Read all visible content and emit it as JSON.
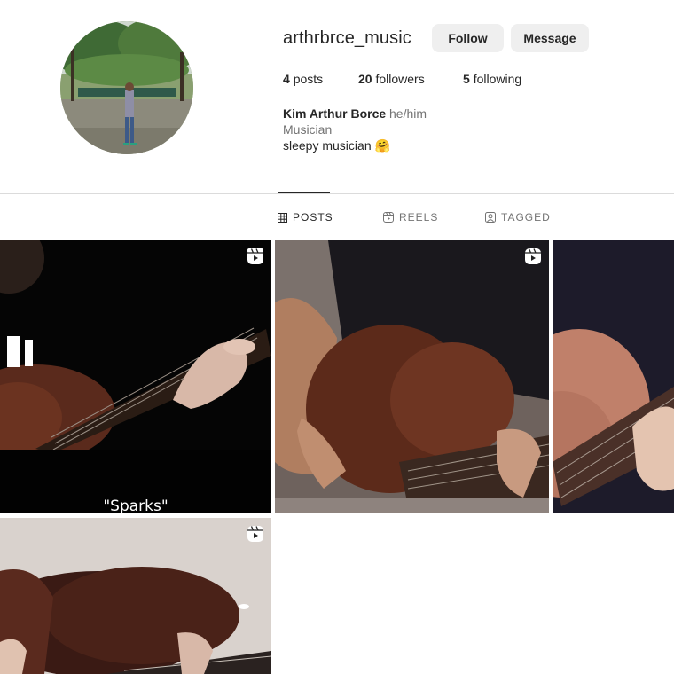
{
  "profile": {
    "username": "arthrbrce_music",
    "follow_label": "Follow",
    "message_label": "Message",
    "stats": {
      "posts_count": "4",
      "posts_label": "posts",
      "followers_count": "20",
      "followers_label": "followers",
      "following_count": "5",
      "following_label": "following"
    },
    "full_name": "Kim Arthur Borce",
    "pronouns": "he/him",
    "category": "Musician",
    "bio": "sleepy musician 🤗"
  },
  "tabs": [
    {
      "label": "POSTS",
      "active": true,
      "icon": "grid-icon"
    },
    {
      "label": "REELS",
      "active": false,
      "icon": "reels-icon"
    },
    {
      "label": "TAGGED",
      "active": false,
      "icon": "tagged-icon"
    }
  ],
  "posts": [
    {
      "type": "reel",
      "caption": "\"Sparks\"",
      "icon": "reel-icon"
    },
    {
      "type": "reel",
      "caption": "",
      "icon": "reel-icon"
    },
    {
      "type": "reel",
      "caption": "",
      "icon": "reel-icon"
    },
    {
      "type": "reel",
      "caption": "",
      "icon": "reel-icon"
    }
  ],
  "colors": {
    "button_bg": "#efefef",
    "text_primary": "#262626",
    "text_secondary": "#737373",
    "divider": "#dbdbdb"
  }
}
